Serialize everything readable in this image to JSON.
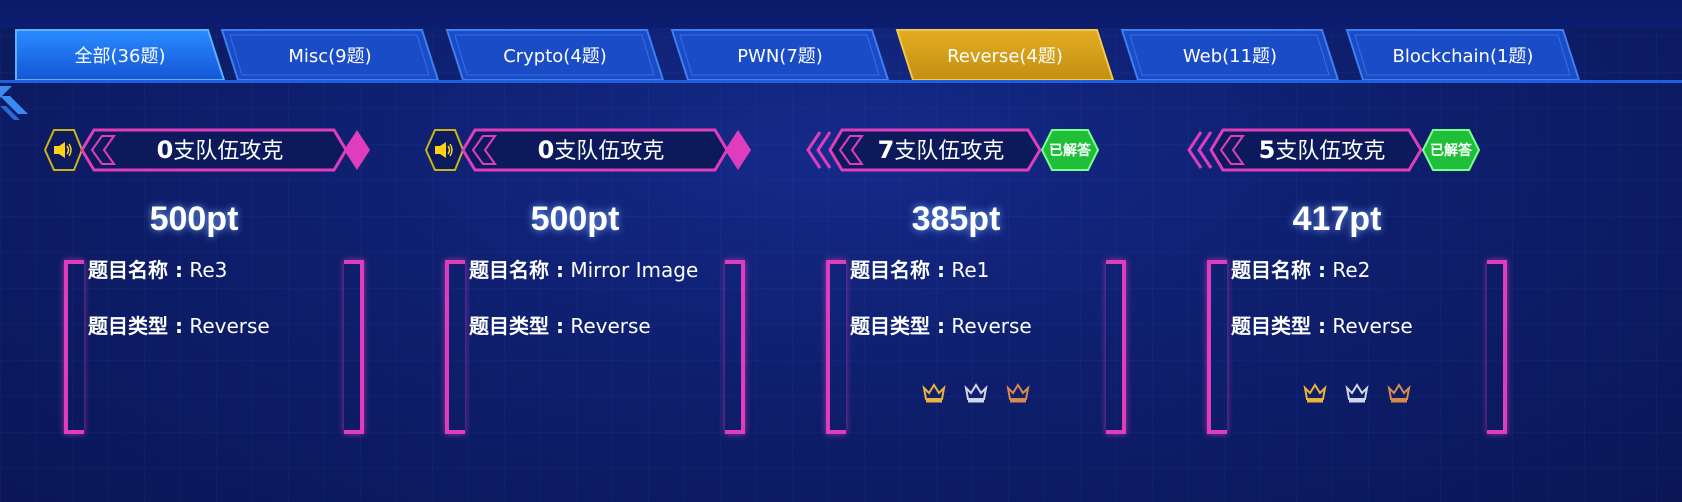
{
  "tabs": [
    {
      "label": "全部(36题)",
      "active": "blue"
    },
    {
      "label": "Misc(9题)",
      "active": "none"
    },
    {
      "label": "Crypto(4题)",
      "active": "none"
    },
    {
      "label": "PWN(7题)",
      "active": "none"
    },
    {
      "label": "Reverse(4题)",
      "active": "gold"
    },
    {
      "label": "Web(11题)",
      "active": "none"
    },
    {
      "label": "Blockchain(1题)",
      "active": "none"
    }
  ],
  "cards": [
    {
      "count": "0",
      "count_suffix": "支队伍攻克",
      "points": "500pt",
      "name_key": "题目名称 :",
      "name": "Re3",
      "type_key": "题目类型 :",
      "type": "Reverse",
      "solved": false,
      "badge": "",
      "icon": "speaker-icon"
    },
    {
      "count": "0",
      "count_suffix": "支队伍攻克",
      "points": "500pt",
      "name_key": "题目名称 :",
      "name": "Mirror Image",
      "type_key": "题目类型 :",
      "type": "Reverse",
      "solved": false,
      "badge": "",
      "icon": "speaker-icon"
    },
    {
      "count": "7",
      "count_suffix": "支队伍攻克",
      "points": "385pt",
      "name_key": "题目名称 :",
      "name": "Re1",
      "type_key": "题目类型 :",
      "type": "Reverse",
      "solved": true,
      "badge": "已解答",
      "icon": "chevron-arrows-icon"
    },
    {
      "count": "5",
      "count_suffix": "支队伍攻克",
      "points": "417pt",
      "name_key": "题目名称 :",
      "name": "Re2",
      "type_key": "题目类型 :",
      "type": "Reverse",
      "solved": true,
      "badge": "已解答",
      "icon": "chevron-arrows-icon"
    }
  ],
  "colors": {
    "accent_pink": "#e03dbd",
    "gold": "#d8a21a",
    "solved_green": "#1fbf3a",
    "tab_blue": "#1a5fd8"
  }
}
